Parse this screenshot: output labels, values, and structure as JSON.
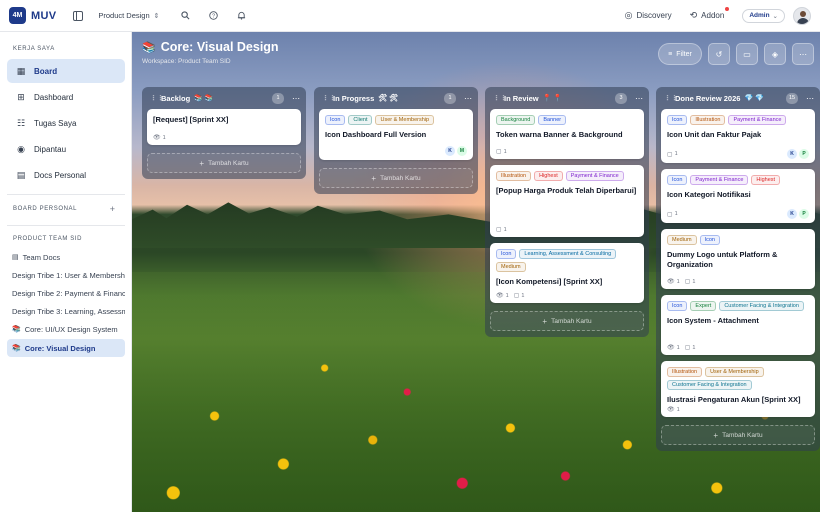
{
  "app": {
    "logo_mark": "4M",
    "logo_text": "MUV"
  },
  "topbar": {
    "workspace_label": "Product Design",
    "discovery_label": "Discovery",
    "addon_label": "Addon",
    "admin_label": "Admin"
  },
  "sidebar": {
    "section_my": "KERJA SAYA",
    "nav": [
      {
        "label": "Board",
        "icon": "board-icon"
      },
      {
        "label": "Dashboard",
        "icon": "dashboard-icon"
      },
      {
        "label": "Tugas Saya",
        "icon": "tasks-icon"
      },
      {
        "label": "Dipantau",
        "icon": "eye-icon"
      },
      {
        "label": "Docs Personal",
        "icon": "document-icon"
      }
    ],
    "section_personal": "BOARD PERSONAL",
    "section_team": "PRODUCT TEAM SID",
    "team_items": [
      {
        "label": "Team Docs"
      },
      {
        "label": "Design Tribe 1: User & Membership"
      },
      {
        "label": "Design Tribe 2: Payment & Finance"
      },
      {
        "label": "Design Tribe 3: Learning, Assessment"
      },
      {
        "label": "Core: UI/UX Design System"
      },
      {
        "label": "Core: Visual Design"
      }
    ]
  },
  "board": {
    "title": "Core: Visual Design",
    "subtitle": "Workspace: Product Team SID",
    "filter_label": "Filter",
    "add_card_label": "Tambah Kartu"
  },
  "columns": [
    {
      "title": "Backlog",
      "emoji": "📚 📚",
      "count": "1",
      "cards": [
        {
          "tags": [],
          "title": "[Request] [Sprint XX]",
          "watch": "1",
          "comments": "",
          "assignees": []
        }
      ]
    },
    {
      "title": "In Progress",
      "emoji": "🛠 🛠",
      "count": "1",
      "cards": [
        {
          "tags": [
            "Icon",
            "Client",
            "User & Membership"
          ],
          "title": "Icon Dashboard Full Version",
          "watch": "",
          "comments": "",
          "assignees": [
            "K",
            "M"
          ]
        }
      ]
    },
    {
      "title": "In Review",
      "emoji": "📍 📍",
      "count": "3",
      "cards": [
        {
          "tags": [
            "Background",
            "Banner"
          ],
          "title": "Token warna Banner & Background",
          "watch": "",
          "comments": "1",
          "assignees": []
        },
        {
          "tags": [
            "Illustration",
            "Highest",
            "Payment & Finance"
          ],
          "title": "[Popup Harga Produk Telah Diperbarui]",
          "watch": "",
          "comments": "1",
          "assignees": []
        },
        {
          "tags": [
            "Icon",
            "Learning, Assessment & Consulting",
            "Medium"
          ],
          "title": "[Icon Kompetensi] [Sprint XX]",
          "watch": "1",
          "comments": "1",
          "assignees": []
        }
      ]
    },
    {
      "title": "Done Review 2026",
      "emoji": "💎 💎",
      "count": "15",
      "cards": [
        {
          "tags": [
            "Icon",
            "Illustration",
            "Payment & Finance"
          ],
          "title": "Icon Unit dan Faktur Pajak",
          "watch": "",
          "comments": "1",
          "assignees": [
            "K",
            "P"
          ]
        },
        {
          "tags": [
            "Icon",
            "Payment & Finance",
            "Highest"
          ],
          "title": "Icon Kategori Notifikasi",
          "watch": "",
          "comments": "1",
          "assignees": [
            "K",
            "P"
          ]
        },
        {
          "tags": [
            "Medium",
            "Icon"
          ],
          "title": "Dummy Logo untuk Platform & Organization",
          "watch": "1",
          "comments": "1",
          "assignees": []
        },
        {
          "tags": [
            "Icon",
            "Expert",
            "Customer Facing & Integration"
          ],
          "title": "Icon System - Attachment",
          "watch": "1",
          "comments": "1",
          "assignees": []
        },
        {
          "tags": [
            "Illustration",
            "User & Membership",
            "Customer Facing & Integration"
          ],
          "title": "Ilustrasi Pengaturan Akun [Sprint XX]",
          "watch": "1",
          "comments": "",
          "assignees": []
        }
      ]
    }
  ],
  "colors": {
    "brand": "#1e3a8a",
    "sidebar_active": "#dbe7f7",
    "tag_Icon": "#1d4ed8",
    "tag_Client": "#0f766e",
    "tag_User & Membership": "#a16207",
    "tag_Background": "#15803d",
    "tag_Banner": "#1d4ed8",
    "tag_Illustration": "#b45309",
    "tag_Highest": "#dc2626",
    "tag_Payment & Finance": "#7e22ce",
    "tag_Learning, Assessment & Consulting": "#0369a1",
    "tag_Medium": "#a16207",
    "tag_Expert": "#15803d",
    "tag_Customer Facing & Integration": "#0e7490"
  }
}
